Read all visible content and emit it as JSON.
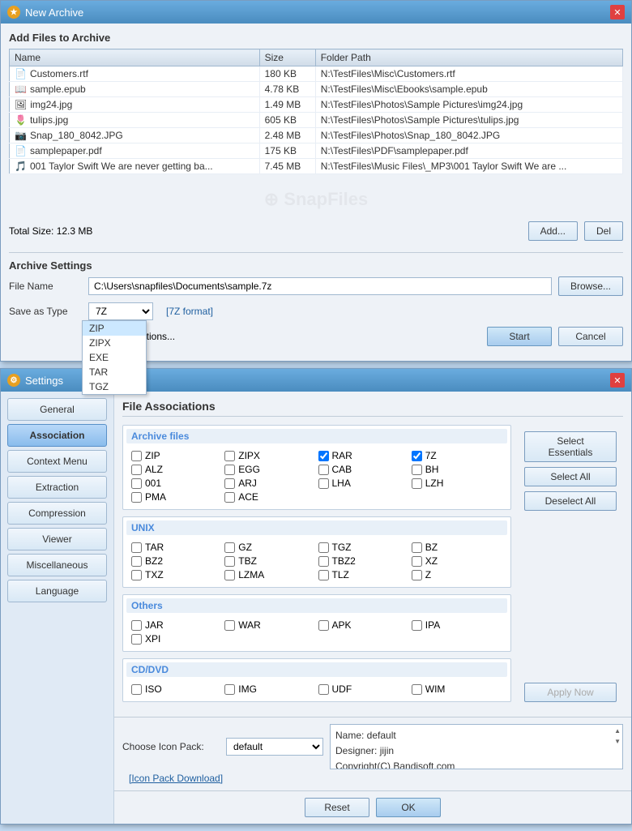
{
  "archive_window": {
    "title": "New Archive",
    "icon": "★",
    "section_title": "Add Files to Archive",
    "table": {
      "headers": [
        "Name",
        "Size",
        "Folder Path"
      ],
      "rows": [
        {
          "icon": "📄",
          "name": "Customers.rtf",
          "size": "180 KB",
          "path": "N:\\TestFiles\\Misc\\Customers.rtf"
        },
        {
          "icon": "📖",
          "name": "sample.epub",
          "size": "4.78 KB",
          "path": "N:\\TestFiles\\Misc\\Ebooks\\sample.epub"
        },
        {
          "icon": "🖼",
          "name": "img24.jpg",
          "size": "1.49 MB",
          "path": "N:\\TestFiles\\Photos\\Sample Pictures\\img24.jpg"
        },
        {
          "icon": "🌷",
          "name": "tulips.jpg",
          "size": "605 KB",
          "path": "N:\\TestFiles\\Photos\\Sample Pictures\\tulips.jpg"
        },
        {
          "icon": "📷",
          "name": "Snap_180_8042.JPG",
          "size": "2.48 MB",
          "path": "N:\\TestFiles\\Photos\\Snap_180_8042.JPG"
        },
        {
          "icon": "📄",
          "name": "samplepaper.pdf",
          "size": "175 KB",
          "path": "N:\\TestFiles\\PDF\\samplepaper.pdf"
        },
        {
          "icon": "🎵",
          "name": "001 Taylor Swift We are never getting ba...",
          "size": "7.45 MB",
          "path": "N:\\TestFiles\\Music Files\\_MP3\\001 Taylor Swift We are ..."
        }
      ]
    },
    "watermark": "SnapFiles",
    "total_size_label": "Total Size:",
    "total_size": "12.3 MB",
    "add_btn": "Add...",
    "del_btn": "Del",
    "settings_title": "Archive Settings",
    "file_name_label": "File Name",
    "file_name_value": "C:\\Users\\snapfiles\\Documents\\sample.7z",
    "browse_btn": "Browse...",
    "save_as_type_label": "Save as Type",
    "format_selected": "7Z",
    "format_label": "[7Z format]",
    "dropdown_options": [
      "ZIP",
      "ZIPX",
      "EXE",
      "TAR",
      "TGZ"
    ],
    "more_options_label": "More Options...",
    "start_btn": "Start",
    "cancel_btn": "Cancel"
  },
  "settings_window": {
    "title": "Settings",
    "icon": "⚙",
    "sidebar": {
      "items": [
        {
          "label": "General",
          "active": false
        },
        {
          "label": "Association",
          "active": true
        },
        {
          "label": "Context Menu",
          "active": false
        },
        {
          "label": "Extraction",
          "active": false
        },
        {
          "label": "Compression",
          "active": false
        },
        {
          "label": "Viewer",
          "active": false
        },
        {
          "label": "Miscellaneous",
          "active": false
        },
        {
          "label": "Language",
          "active": false
        }
      ]
    },
    "content_title": "File Associations",
    "sections": {
      "archive": {
        "title": "Archive files",
        "items": [
          {
            "label": "ZIP",
            "checked": false
          },
          {
            "label": "ZIPX",
            "checked": false
          },
          {
            "label": "RAR",
            "checked": true
          },
          {
            "label": "7Z",
            "checked": true
          },
          {
            "label": "ALZ",
            "checked": false
          },
          {
            "label": "EGG",
            "checked": false
          },
          {
            "label": "CAB",
            "checked": false
          },
          {
            "label": "BH",
            "checked": false
          },
          {
            "label": "001",
            "checked": false
          },
          {
            "label": "ARJ",
            "checked": false
          },
          {
            "label": "LHA",
            "checked": false
          },
          {
            "label": "LZH",
            "checked": false
          },
          {
            "label": "PMA",
            "checked": false
          },
          {
            "label": "ACE",
            "checked": false
          },
          {
            "label": "",
            "checked": false
          },
          {
            "label": "",
            "checked": false
          }
        ]
      },
      "unix": {
        "title": "UNIX",
        "items": [
          {
            "label": "TAR",
            "checked": false
          },
          {
            "label": "GZ",
            "checked": false
          },
          {
            "label": "TGZ",
            "checked": false
          },
          {
            "label": "BZ",
            "checked": false
          },
          {
            "label": "BZ2",
            "checked": false
          },
          {
            "label": "TBZ",
            "checked": false
          },
          {
            "label": "TBZ2",
            "checked": false
          },
          {
            "label": "XZ",
            "checked": false
          },
          {
            "label": "TXZ",
            "checked": false
          },
          {
            "label": "LZMA",
            "checked": false
          },
          {
            "label": "TLZ",
            "checked": false
          },
          {
            "label": "Z",
            "checked": false
          }
        ]
      },
      "others": {
        "title": "Others",
        "items": [
          {
            "label": "JAR",
            "checked": false
          },
          {
            "label": "WAR",
            "checked": false
          },
          {
            "label": "APK",
            "checked": false
          },
          {
            "label": "IPA",
            "checked": false
          },
          {
            "label": "XPI",
            "checked": false
          },
          {
            "label": "",
            "checked": false
          },
          {
            "label": "",
            "checked": false
          },
          {
            "label": "",
            "checked": false
          }
        ]
      },
      "cddvd": {
        "title": "CD/DVD",
        "items": [
          {
            "label": "ISO",
            "checked": false
          },
          {
            "label": "IMG",
            "checked": false
          },
          {
            "label": "UDF",
            "checked": false
          },
          {
            "label": "WIM",
            "checked": false
          }
        ]
      }
    },
    "right_panel": {
      "select_essentials_btn": "Select Essentials",
      "select_all_btn": "Select All",
      "deselect_all_btn": "Deselect All",
      "apply_btn": "Apply Now"
    },
    "bottom": {
      "choose_icon_pack_label": "Choose Icon Pack:",
      "icon_pack_value": "default",
      "icon_info_name": "Name: default",
      "icon_info_designer": "Designer: jijin",
      "icon_info_copyright": "Copyright(C) Bandisoft.com",
      "download_link": "[Icon Pack Download]"
    },
    "footer": {
      "reset_btn": "Reset",
      "ok_btn": "OK"
    }
  }
}
